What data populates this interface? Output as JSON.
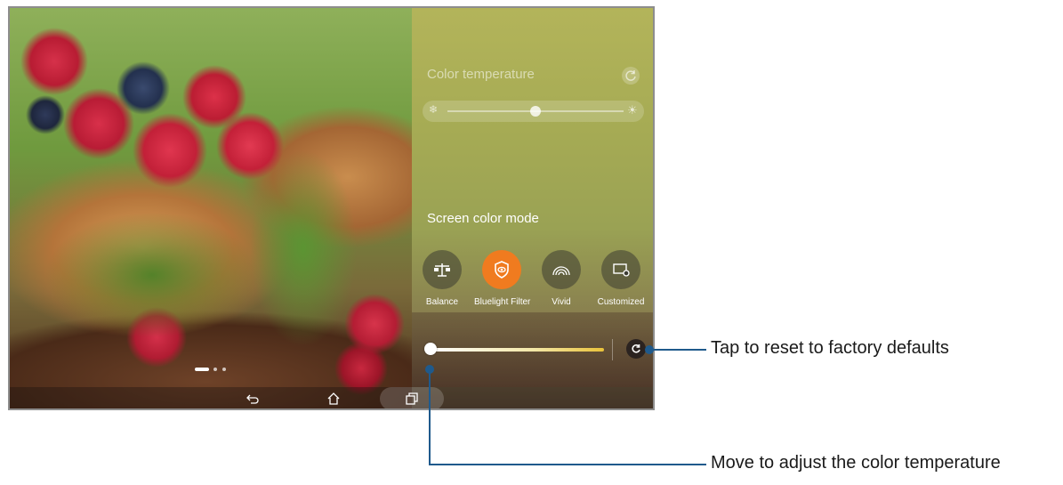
{
  "color_temperature": {
    "title": "Color temperature",
    "reset_icon": "refresh-icon",
    "cold_icon": "snowflake-icon",
    "warm_icon": "sun-icon",
    "level": 0.5
  },
  "screen_color_mode": {
    "title": "Screen color mode",
    "modes": [
      {
        "label": "Balance",
        "icon": "scale-icon",
        "selected": false
      },
      {
        "label": "Bluelight Filter",
        "icon": "eye-shield-icon",
        "selected": true
      },
      {
        "label": "Vivid",
        "icon": "rainbow-icon",
        "selected": false
      },
      {
        "label": "Customized",
        "icon": "screen-settings-icon",
        "selected": false
      }
    ],
    "accent_color": "#f07b1f"
  },
  "bluelight_slider": {
    "level": 0.0,
    "reset_icon": "refresh-icon"
  },
  "page_indicator": {
    "pages": 3,
    "current": 1
  },
  "navigation": {
    "back_icon": "back-icon",
    "home_icon": "home-icon",
    "recent_icon": "recent-apps-icon"
  },
  "annotations": {
    "reset": "Tap to reset to factory defaults",
    "slider": "Move to adjust the color temperature",
    "line_color": "#1f5a8c"
  }
}
